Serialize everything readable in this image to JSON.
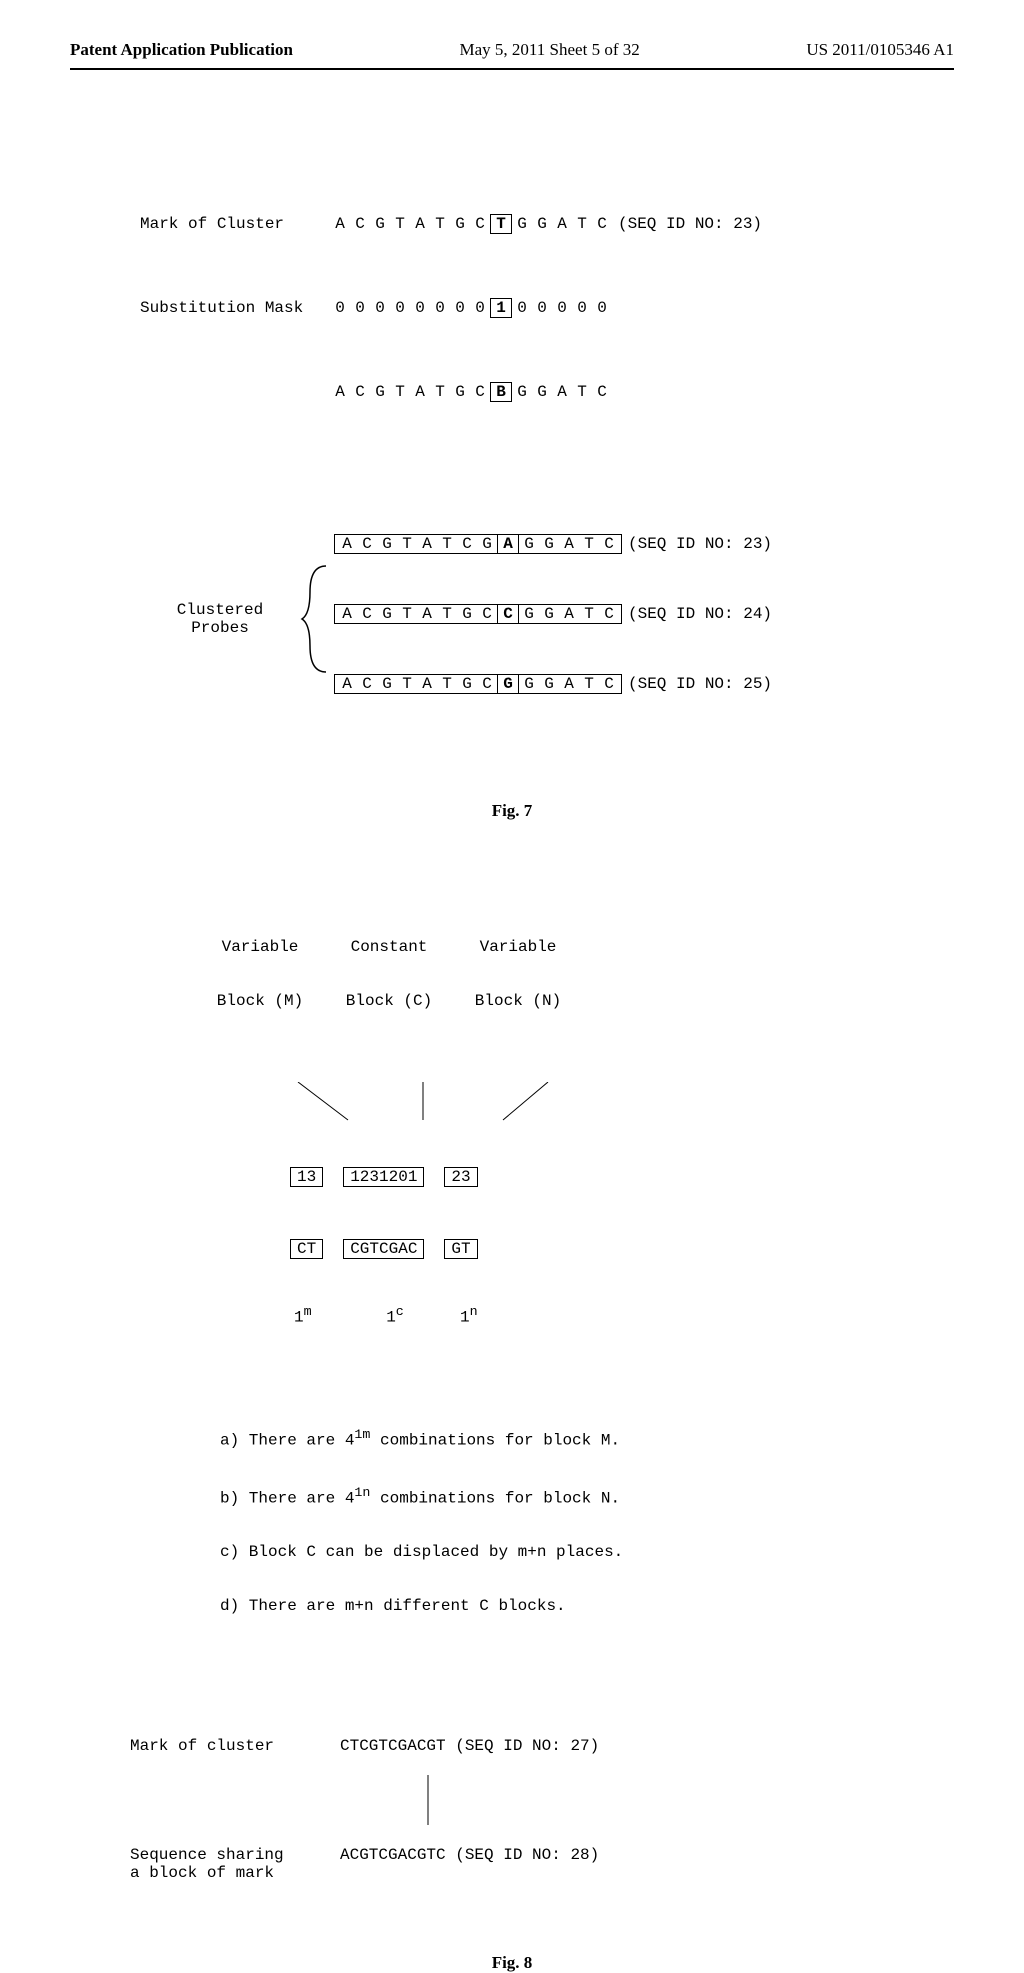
{
  "header": {
    "left": "Patent Application Publication",
    "center": "May 5, 2011  Sheet 5 of 32",
    "right": "US 2011/0105346 A1"
  },
  "fig7": {
    "rows": [
      {
        "label": "Mark of Cluster",
        "pre": [
          "A",
          "C",
          "G",
          "T",
          "A",
          "T",
          "G",
          "C"
        ],
        "boxed": "T",
        "post": [
          "G",
          "G",
          "A",
          "T",
          "C"
        ],
        "seqid": "(SEQ ID NO: 23)"
      },
      {
        "label": "Substitution Mask",
        "pre": [
          "0",
          "0",
          "0",
          "0",
          "0",
          "0",
          "0",
          "0"
        ],
        "boxed": "1",
        "post": [
          "0",
          "0",
          "0",
          "0",
          "0"
        ],
        "seqid": ""
      },
      {
        "label": "",
        "pre": [
          "A",
          "C",
          "G",
          "T",
          "A",
          "T",
          "G",
          "C"
        ],
        "boxed": "B",
        "post": [
          "G",
          "G",
          "A",
          "T",
          "C"
        ],
        "seqid": ""
      }
    ],
    "cluster_label": "Clustered\nProbes",
    "probes": [
      {
        "pre": [
          "A",
          "C",
          "G",
          "T",
          "A",
          "T",
          "C",
          "G"
        ],
        "boxed": "A",
        "post": [
          "G",
          "G",
          "A",
          "T",
          "C"
        ],
        "seqid": "(SEQ ID NO: 23)"
      },
      {
        "pre": [
          "A",
          "C",
          "G",
          "T",
          "A",
          "T",
          "G",
          "C"
        ],
        "boxed": "C",
        "post": [
          "G",
          "G",
          "A",
          "T",
          "C"
        ],
        "seqid": "(SEQ ID NO: 24)"
      },
      {
        "pre": [
          "A",
          "C",
          "G",
          "T",
          "A",
          "T",
          "G",
          "C"
        ],
        "boxed": "G",
        "post": [
          "G",
          "G",
          "A",
          "T",
          "C"
        ],
        "seqid": "(SEQ ID NO: 25)"
      }
    ],
    "caption": "Fig. 7"
  },
  "fig8": {
    "col_labels": [
      {
        "top": "Variable",
        "bottom": "Block (M)"
      },
      {
        "top": "Constant",
        "bottom": "Block (C)"
      },
      {
        "top": "Variable",
        "bottom": "Block (N)"
      }
    ],
    "num_row": [
      "13",
      "1231201",
      "23"
    ],
    "seq_row": [
      "CT",
      "CGTCGAC",
      "GT"
    ],
    "sup_row": [
      "1",
      "1",
      "1"
    ],
    "sup_exp": [
      "m",
      "c",
      "n"
    ],
    "notes": [
      "a) There are 4",
      " combinations for block M.",
      "b) There are 4",
      " combinations for block N.",
      "c) Block C can be displaced by m+n places.",
      "d) There are m+n different C blocks."
    ],
    "note_exp": [
      "1m",
      "1n"
    ],
    "bottom": [
      {
        "label": "Mark of cluster",
        "seq": "CTCGTCGACGT (SEQ ID NO: 27)"
      },
      {
        "label": "Sequence sharing\na block of mark",
        "seq": "ACGTCGACGTC (SEQ ID NO: 28)"
      }
    ],
    "caption": "Fig. 8"
  },
  "chart_data": {
    "type": "table",
    "title": "Patent figure sheet — cluster mark / substitution mask and block combinatorics",
    "fig7_sequences": {
      "mark_of_cluster": {
        "sequence": "ACGTATGCTGGATC",
        "highlight_index": 8,
        "highlight_char": "T",
        "seq_id": 23
      },
      "substitution_mask": {
        "sequence": "00000000100000",
        "highlight_index": 8,
        "highlight_char": "1"
      },
      "degenerate": {
        "sequence": "ACGTATGCBGGATC",
        "highlight_index": 8,
        "highlight_char": "B"
      },
      "clustered_probes": [
        {
          "sequence": "ACGTATCGAGGATC",
          "highlight_index": 8,
          "highlight_char": "A",
          "seq_id": 23
        },
        {
          "sequence": "ACGTATGCCGGATC",
          "highlight_index": 8,
          "highlight_char": "C",
          "seq_id": 24
        },
        {
          "sequence": "ACGTATGCGGGATC",
          "highlight_index": 8,
          "highlight_char": "G",
          "seq_id": 25
        }
      ]
    },
    "fig8_blocks": {
      "variable_M": {
        "digits": "13",
        "bases": "CT",
        "length_symbol": "1^m"
      },
      "constant_C": {
        "digits": "1231201",
        "bases": "CGTCGAC",
        "length_symbol": "1^c"
      },
      "variable_N": {
        "digits": "23",
        "bases": "GT",
        "length_symbol": "1^n"
      },
      "combination_rules": [
        "4^(1m) combinations for block M",
        "4^(1n) combinations for block N",
        "Block C can be displaced by m+n places",
        "There are m+n different C blocks"
      ],
      "mark_of_cluster": {
        "sequence": "CTCGTCGACGT",
        "seq_id": 27
      },
      "shared_block_sequence": {
        "sequence": "ACGTCGACGTC",
        "seq_id": 28
      }
    }
  }
}
